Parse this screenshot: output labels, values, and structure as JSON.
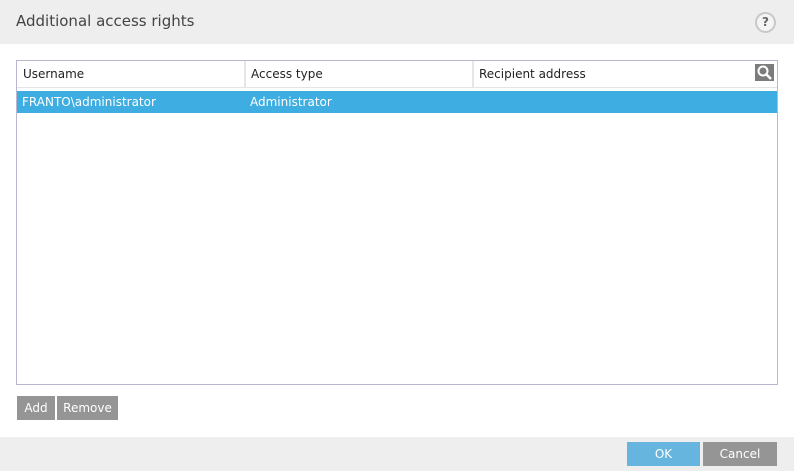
{
  "dialog": {
    "title": "Additional access rights",
    "help_label": "?"
  },
  "table": {
    "columns": [
      "Username",
      "Access type",
      "Recipient address"
    ],
    "rows": [
      {
        "username": "FRANTO\\administrator",
        "access_type": "Administrator",
        "recipient": "",
        "selected": true
      }
    ]
  },
  "actions": {
    "add": "Add",
    "remove": "Remove"
  },
  "footer": {
    "ok": "OK",
    "cancel": "Cancel"
  },
  "colors": {
    "selection": "#3eade2",
    "ok": "#66b5de",
    "button": "#959595"
  }
}
